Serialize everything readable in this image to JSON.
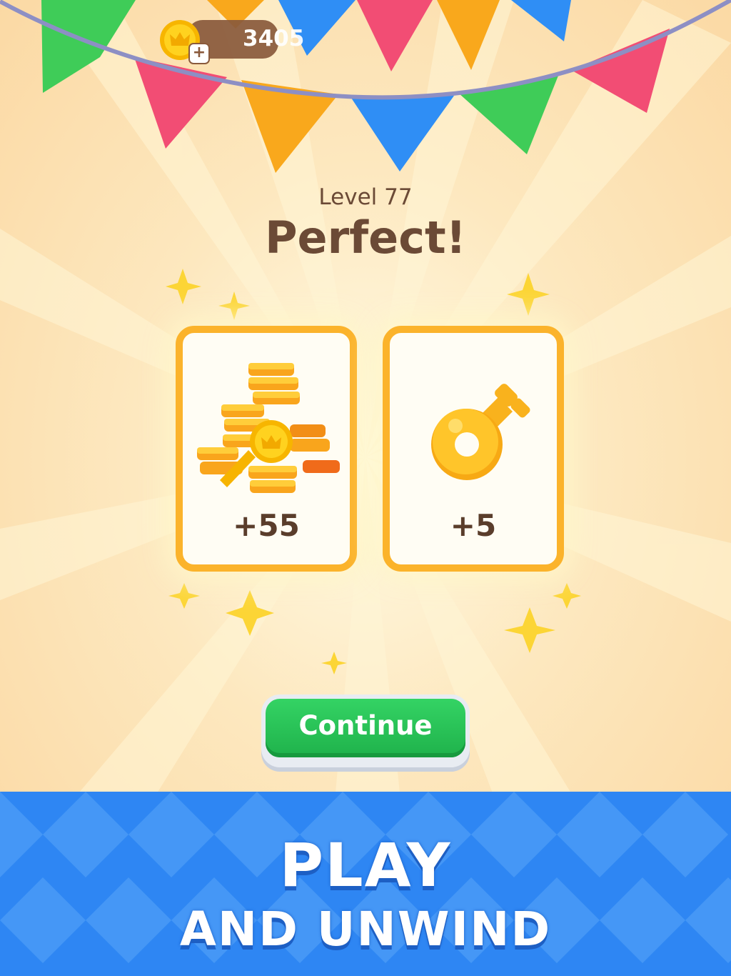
{
  "hud": {
    "coins": "3405",
    "plus_symbol": "+"
  },
  "result": {
    "level_label": "Level 77",
    "title": "Perfect!"
  },
  "rewards": [
    {
      "name": "coins",
      "amount": "+55"
    },
    {
      "name": "key",
      "amount": "+5"
    }
  ],
  "continue_button": {
    "label": "Continue"
  },
  "promo": {
    "line1": "PLAY",
    "line2": "AND UNWIND"
  },
  "colors": {
    "accent_green": "#22c055",
    "card_border": "#fbb32b",
    "banner_blue": "#2e86f3",
    "text_brown": "#6b4a36"
  }
}
